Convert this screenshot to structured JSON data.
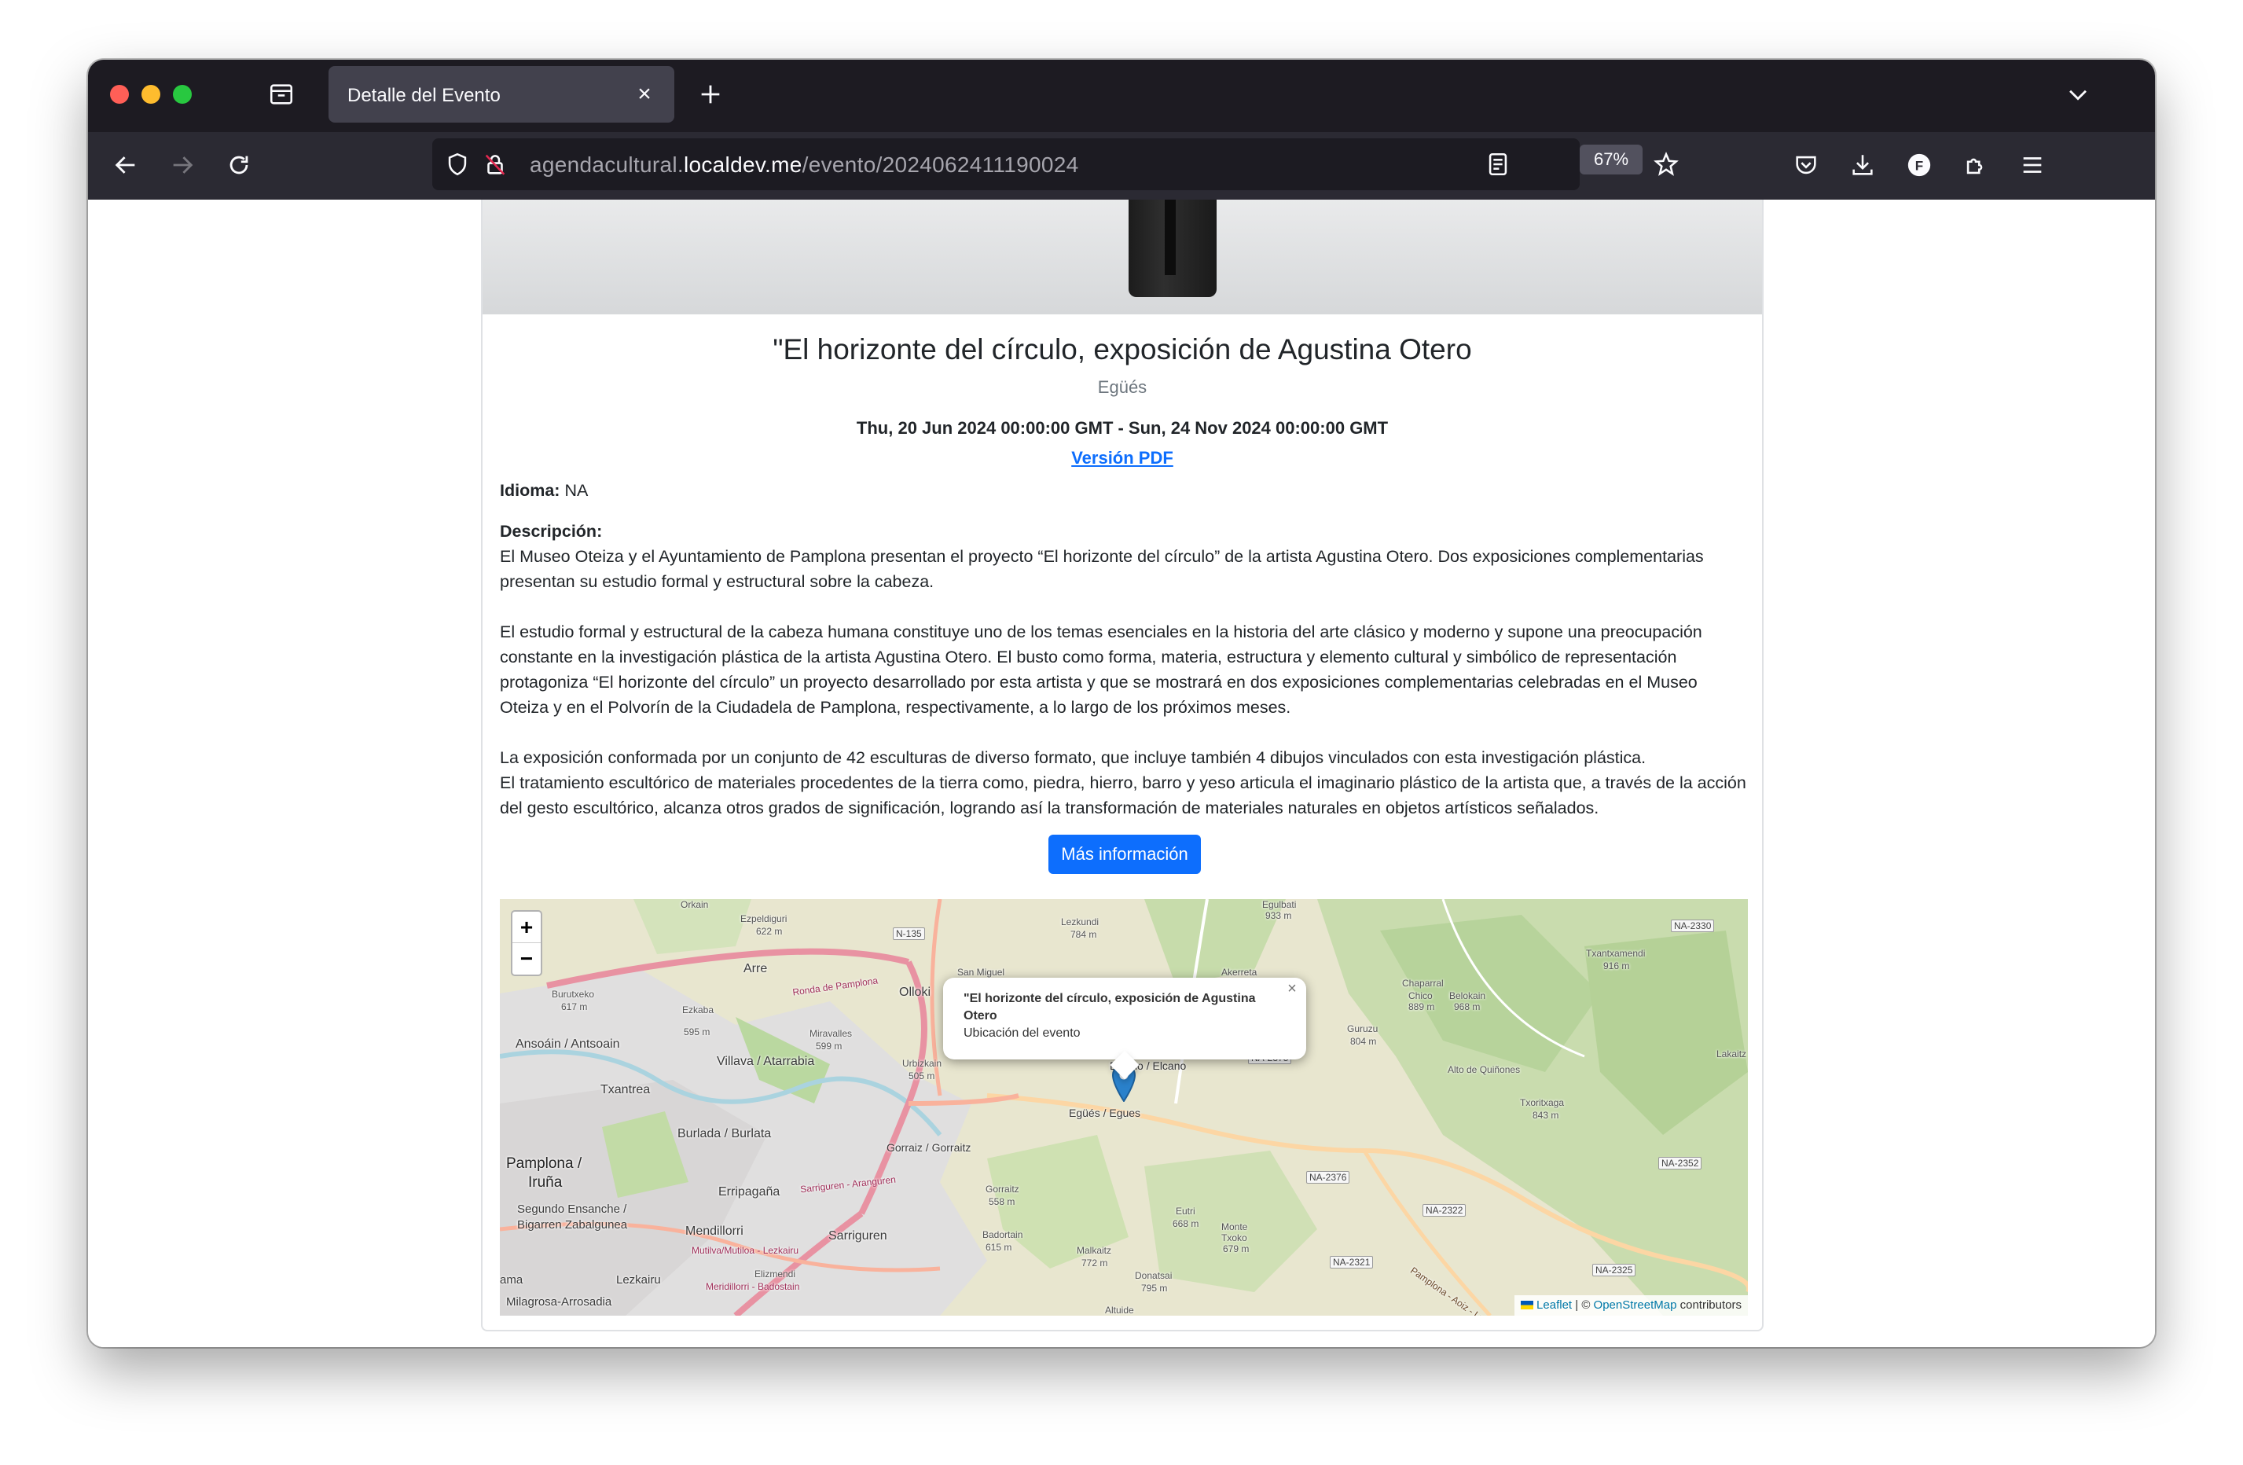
{
  "browser": {
    "tab_title": "Detalle del Evento",
    "url_prefix": "agendacultural.",
    "url_domain": "localdev.me",
    "url_path": "/evento/2024062411190024",
    "zoom": "67%",
    "avatar_letter": "F",
    "colors": {
      "tab_bar": "#1d1b22",
      "nav_bar": "#2b2a33",
      "active_tab": "#42414d"
    }
  },
  "event": {
    "title": "\"El horizonte del círculo, exposición de Agustina Otero",
    "location": "Egüés",
    "dates": "Thu, 20 Jun 2024 00:00:00 GMT - Sun, 24 Nov 2024 00:00:00 GMT",
    "pdf_link": "Versión PDF",
    "language_label": "Idioma:",
    "language_value": "NA",
    "description_label": "Descripción:",
    "description_p1": "El Museo Oteiza y el Ayuntamiento de Pamplona presentan el proyecto “El horizonte del círculo” de la artista Agustina Otero. Dos exposiciones complementarias presentan su estudio formal y estructural sobre la cabeza.",
    "description_p2": "El estudio formal y estructural de la cabeza humana constituye uno de los temas esenciales en la historia del arte clásico y moderno y supone una preocupación constante en la investigación plástica de la artista Agustina Otero. El busto como forma, materia, estructura y elemento cultural y simbólico de representación protagoniza “El horizonte del círculo” un proyecto desarrollado por esta artista y que se mostrará en dos exposiciones complementarias celebradas en el Museo Oteiza y en el Polvorín de la Ciudadela de Pamplona, respectivamente, a lo largo de los próximos meses.",
    "description_p3a": "La exposición conformada por un conjunto de 42 esculturas de diverso formato, que incluye también 4 dibujos vinculados con esta investigación plástica.",
    "description_p3b": "El tratamiento escultórico de materiales procedentes de la tierra como, piedra, hierro, barro y yeso articula el imaginario plástico de la artista que, a través de la acción del gesto escultórico, alcanza otros grados de significación, logrando así la transformación de materiales naturales en objetos artísticos señalados.",
    "more_info_button": "Más información",
    "button_color": "#0d6efd"
  },
  "map": {
    "zoom_in": "+",
    "zoom_out": "−",
    "popup_title": "\"El horizonte del círculo, exposición de Agustina Otero",
    "popup_subtitle": "Ubicación del evento",
    "popup_close": "×",
    "attribution_leaflet": "Leaflet",
    "attribution_sep": " | © ",
    "attribution_osm": "OpenStreetMap",
    "attribution_tail": " contributors",
    "labels": {
      "orkain": "Orkain",
      "ezpeldiguri": "Ezpeldiguri",
      "ezpeldiguri_h": "622 m",
      "n135": "N-135",
      "lezkundi": "Lezkundi",
      "lezkundi_h": "784 m",
      "egulbati": "Egulbati",
      "egulbati_h": "933 m",
      "na2330": "NA-2330",
      "arre": "Arre",
      "olloki": "Olloki",
      "san_miguel": "San Miguel",
      "akerreta": "Akerreta",
      "txantxamendi": "Txantxamendi",
      "txantxamendi_h": "916 m",
      "burutxeko": "Burutxeko",
      "burutxeko_h": "617 m",
      "ronda": "Ronda de Pamplona",
      "ezkaba": "Ezkaba",
      "ezkaba_h": "595 m",
      "chaparral": "Chaparral",
      "chico": "Chico",
      "chico_h": "889 m",
      "belokain": "Belokain",
      "belokain_h": "968 m",
      "ansoain": "Ansoáin / Antsoain",
      "villava": "Villava / Atarrabia",
      "miravalles": "Miravalles",
      "miravalles_h": "599 m",
      "urbizkain": "Urbizkain",
      "urbizkain_h": "505 m",
      "elkano": "Elkano / Elcano",
      "na2375": "NA-2375",
      "guruzu": "Guruzu",
      "guruzu_h": "804 m",
      "lakaitz": "Lakaitz",
      "txantrea": "Txantrea",
      "egues": "Egüés / Egues",
      "alto_quinones": "Alto de Quiñones",
      "txoritxaga": "Txoritxaga",
      "txoritxaga_h": "843 m",
      "pamplona": "Pamplona /",
      "iruna": "Iruña",
      "burlada": "Burlada / Burlata",
      "gorraiz": "Gorraiz / Gorraitz",
      "na2376": "NA-2376",
      "na2352": "NA-2352",
      "errripagana": "Erripagaña",
      "sarriguren_road": "Sarriguren - Aranguren",
      "gorraitz": "Gorraitz",
      "gorraitz_h": "558 m",
      "segundo": "Segundo Ensanche /",
      "bigarren": "Bigarren Zabalgunea",
      "mendillorri": "Mendillorri",
      "sarriguren": "Sarriguren",
      "eutri": "Eutri",
      "eutri_h": "668 m",
      "monte": "Monte",
      "txoko": "Txoko",
      "txoko_h": "679 m",
      "na2322": "NA-2322",
      "mutilva": "Mutilva/Mutiloa - Lezkairu",
      "badortain": "Badortain",
      "badortain_h": "615 m",
      "malkaitz": "Malkaitz",
      "malkaitz_h": "772 m",
      "na2321": "NA-2321",
      "lezkairu": "Lezkairu",
      "elizmendi": "Elizmendi",
      "meridilorri": "Meridillorri - Badostain",
      "donatsai": "Donatsai",
      "donatsai_h": "795 m",
      "na2325": "NA-2325",
      "milagrosa": "Milagrosa-Arrosadia",
      "ama": "ama",
      "altuide": "Altuide",
      "pamplona_aoiz": "Pamplona - Aoiz - Lu"
    }
  }
}
